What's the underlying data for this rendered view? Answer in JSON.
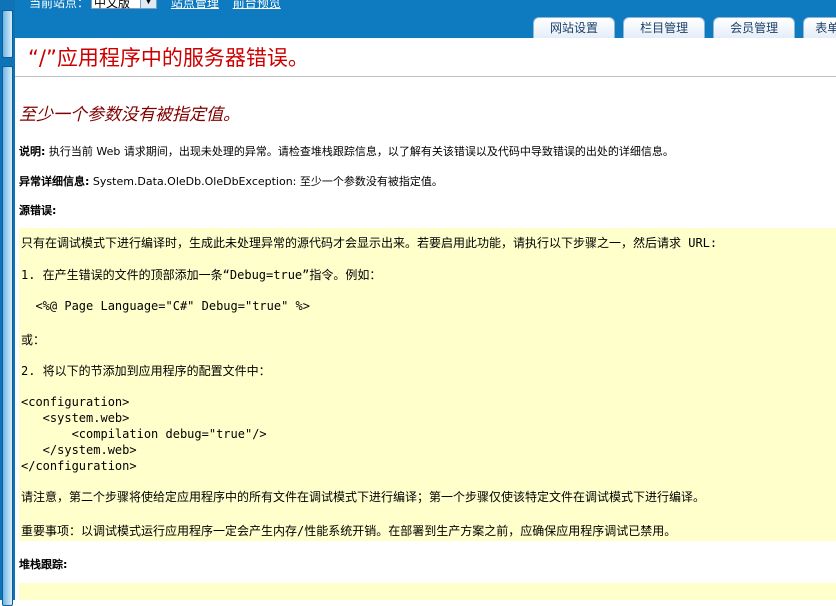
{
  "site_bar": {
    "label": "当前站点：",
    "selected_site": "中文版",
    "links": [
      "站点管理",
      "前台预览"
    ]
  },
  "tabs": [
    {
      "label": "网站设置"
    },
    {
      "label": "栏目管理"
    },
    {
      "label": "会员管理"
    },
    {
      "label": "表单留"
    }
  ],
  "error": {
    "title": "“/”应用程序中的服务器错误。",
    "subtitle": "至少一个参数没有被指定值。",
    "description_label": "说明:",
    "description_text": "执行当前 Web 请求期间，出现未处理的异常。请检查堆栈跟踪信息，以了解有关该错误以及代码中导致错误的出处的详细信息。",
    "exception_label": "异常详细信息:",
    "exception_text": "System.Data.OleDb.OleDbException: 至少一个参数没有被指定值。",
    "source_label": "源错误:",
    "source_box": {
      "intro": "只有在调试模式下进行编译时，生成此未处理异常的源代码才会显示出来。若要启用此功能，请执行以下步骤之一，然后请求 URL:",
      "step1": "1. 在产生错误的文件的顶部添加一条“Debug=true”指令。例如：",
      "step1_code": "  <%@ Page Language=\"C#\" Debug=\"true\" %>",
      "or": "或：",
      "step2": "2. 将以下的节添加到应用程序的配置文件中：",
      "config_code": "<configuration>\n   <system.web>\n       <compilation debug=\"true\"/>\n   </system.web>\n</configuration>",
      "note": "请注意，第二个步骤将使给定应用程序中的所有文件在调试模式下进行编译；第一个步骤仅使该特定文件在调试模式下进行编译。",
      "important": "重要事项：以调试模式运行应用程序一定会产生内存/性能系统开销。在部署到生产方案之前，应确保应用程序调试已禁用。"
    },
    "stack_label": "堆栈跟踪:"
  }
}
